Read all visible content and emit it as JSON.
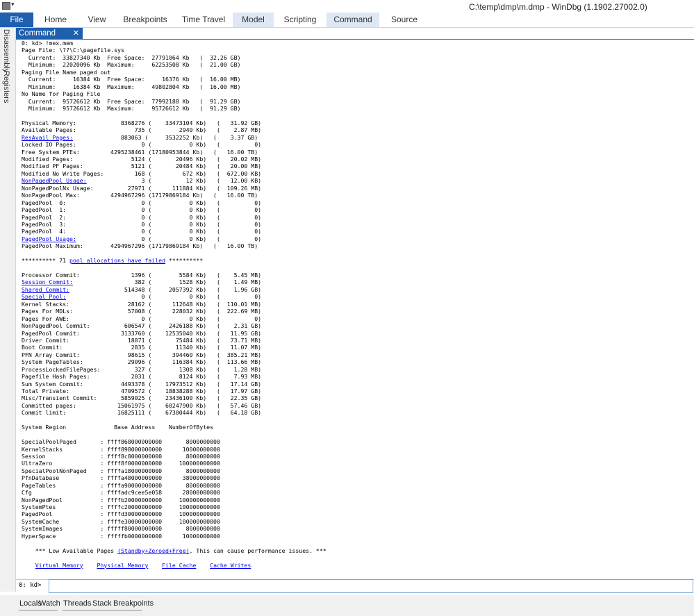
{
  "window": {
    "title": "C:\\temp\\dmp\\m.dmp - WinDbg (1.1902.27002.0)"
  },
  "ribbon": {
    "file": "File",
    "tabs": [
      "Home",
      "View",
      "Breakpoints",
      "Time Travel",
      "Model",
      "Scripting",
      "Command",
      "Source"
    ]
  },
  "left_panel": {
    "disassembly": "Disassembly",
    "registers": "Registers"
  },
  "document": {
    "tab_label": "Command",
    "close": "✕"
  },
  "output": {
    "lines": [
      "0: kd> !mex.mem",
      "Page File: \\??\\C:\\pagefile.sys",
      "  Current:  33827340 Kb  Free Space:  27791064 Kb   (  32.26 GB)",
      "  Minimum:  22020096 Kb  Maximum:     62253508 Kb   (  21.00 GB)",
      "Paging File Name paged out",
      "  Current:     16384 Kb  Free Space:     16376 Kb   (  16.00 MB)",
      "  Minimum:     16384 Kb  Maximum:     49802804 Kb   (  16.00 MB)",
      "No Name for Paging File",
      "  Current:  95726612 Kb  Free Space:  77992188 Kb   (  91.29 GB)",
      "  Minimum:  95726612 Kb  Maximum:     95726612 Kb   (  91.29 GB)",
      "",
      "Physical Memory:             8368276 (    33473104 Kb)   (   31.92 GB)",
      "Available Pages:                 735 (        2940 Kb)   (    2.87 MB)",
      "[[ResAvail Pages:]]              883063 (     3532252 Kb)   (    3.37 GB)",
      "Locked IO Pages:                   0 (           0 Kb)   (          0)",
      "Free System PTEs:         4295238461 (17180953844 Kb)   (   16.00 TB)",
      "Modified Pages:                 5124 (       20496 Kb)   (   20.02 MB)",
      "Modified PF Pages:              5121 (       20484 Kb)   (   20.00 MB)",
      "Modified No Write Pages:         168 (         672 Kb)   (  672.00 KB)",
      "[[NonPagedPool Usage:]]                3 (          12 Kb)   (   12.00 KB)",
      "NonPagedPoolNx Usage:          27971 (      111884 Kb)   (  109.26 MB)",
      "NonPagedPool Max:         4294967296 (17179869184 Kb)   (   16.00 TB)",
      "PagedPool  0:                      0 (           0 Kb)   (          0)",
      "PagedPool  1:                      0 (           0 Kb)   (          0)",
      "PagedPool  2:                      0 (           0 Kb)   (          0)",
      "PagedPool  3:                      0 (           0 Kb)   (          0)",
      "PagedPool  4:                      0 (           0 Kb)   (          0)",
      "[[PagedPool Usage:]]                   0 (           0 Kb)   (          0)",
      "PagedPool Maximum:        4294967296 (17179869184 Kb)   (   16.00 TB)",
      "",
      "********** 71 [[pool allocations have failed]] **********",
      "",
      "Processor Commit:               1396 (        5584 Kb)   (    5.45 MB)",
      "[[Session Commit:]]                  382 (        1528 Kb)   (    1.49 MB)",
      "[[Shared Commit:]]                514348 (     2057392 Kb)   (    1.96 GB)",
      "[[Special Pool:]]                      0 (           0 Kb)   (          0)",
      "Kernel Stacks:                 28162 (      112648 Kb)   (  110.01 MB)",
      "Pages For MDLs:                57008 (      228032 Kb)   (  222.69 MB)",
      "Pages For AWE:                     0 (           0 Kb)   (          0)",
      "NonPagedPool Commit:          606547 (     2426188 Kb)   (    2.31 GB)",
      "PagedPool Commit:            3133760 (    12535040 Kb)   (   11.95 GB)",
      "Driver Commit:                 18871 (       75484 Kb)   (   73.71 MB)",
      "Boot Commit:                    2835 (       11340 Kb)   (   11.07 MB)",
      "PFN Array Commit:              98615 (      394460 Kb)   (  385.21 MB)",
      "System PageTables:             29096 (      116384 Kb)   (  113.66 MB)",
      "ProcessLockedFilePages:          327 (        1308 Kb)   (    1.28 MB)",
      "Pagefile Hash Pages:            2031 (        8124 Kb)   (    7.93 MB)",
      "Sum System Commit:           4493378 (    17973512 Kb)   (   17.14 GB)",
      "Total Private:               4709572 (    18838288 Kb)   (   17.97 GB)",
      "Misc/Transient Commit:       5859025 (    23436100 Kb)   (   22.35 GB)",
      "Committed pages:            15061975 (    60247900 Kb)   (   57.46 GB)",
      "Commit limit:               16825111 (    67300444 Kb)   (   64.18 GB)",
      "",
      "System Region              Base Address    NumberOfBytes",
      "",
      "SpecialPoolPaged       : ffff868000000000       8000000000",
      "KernelStacks           : ffff898000000000      10000000000",
      "Session                : ffff8c8000000000       8000000000",
      "UltraZero              : ffff8f0000000000     100000000000",
      "SpecialPoolNonPaged    : ffffa18000000000       8000000000",
      "PfnDatabase            : ffffa48000000000      38000000000",
      "PageTables             : ffffa90000000000       8000000000",
      "Cfg                    : ffffadc9cee5e058      28000000000",
      "NonPagedPool           : ffffb20000000000     100000000000",
      "SystemPtes             : ffffc20000000000     100000000000",
      "PagedPool              : ffffd30000000000     100000000000",
      "SystemCache            : ffffe30000000000     100000000000",
      "SystemImages           : fffff80000000000       8000000000",
      "HyperSpace             : fffffb0000000000      10000000000",
      "",
      "    *** Low Available Pages [[(Standby+Zeroed+Free)]]. This can cause performance issues. ***",
      "",
      "    [[Virtual Memory]]    [[Physical Memory]]    [[File Cache]]    [[Cache Writes]]"
    ]
  },
  "command_bar": {
    "prompt": "0: kd>",
    "value": ""
  },
  "bottom_tabs": [
    "Locals",
    "Watch",
    "Threads",
    "Stack",
    "Breakpoints"
  ],
  "colors": {
    "accent": "#1e5fae",
    "active_tab": "#dde8f4",
    "link": "#0000ee"
  }
}
